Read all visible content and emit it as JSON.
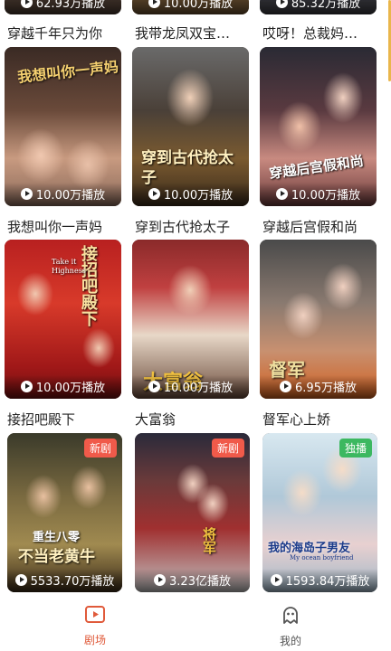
{
  "top_row": {
    "counts": [
      "62.93万播放",
      "10.00万播放",
      "85.32万播放"
    ],
    "titles": [
      "穿越千年只为你",
      "我带龙凤双宝…",
      "哎呀！总裁妈…"
    ]
  },
  "row1": [
    {
      "count": "10.00万播放",
      "poster_text": "我想叫你一声妈"
    },
    {
      "count": "10.00万播放",
      "poster_text": "穿到古代抢太子"
    },
    {
      "count": "10.00万播放",
      "poster_text": "穿越后宫假和尚"
    }
  ],
  "row1_titles": [
    "我想叫你一声妈",
    "穿到古代抢太子",
    "穿越后宫假和尚"
  ],
  "row2": [
    {
      "count": "10.00万播放",
      "poster_text": "接招吧殿下",
      "poster_sub": "Take it Highness"
    },
    {
      "count": "10.00万播放",
      "poster_text": "大富翁"
    },
    {
      "count": "6.95万播放",
      "poster_text": "督军"
    }
  ],
  "row2_titles": [
    "接招吧殿下",
    "大富翁",
    "督军心上娇"
  ],
  "row3": [
    {
      "count": "5533.70万播放",
      "badge": "新剧",
      "poster_text": "不当老黄牛",
      "poster_sub": "重生八零"
    },
    {
      "count": "3.23亿播放",
      "badge": "新剧",
      "poster_text": "将军"
    },
    {
      "count": "1593.84万播放",
      "badge": "独播",
      "poster_text": "我的海岛子男友",
      "poster_sub": "My ocean boyfriend"
    }
  ],
  "tabbar": {
    "theater_label": "剧场",
    "mine_label": "我的"
  },
  "colors": {
    "accent": "#e05a3a",
    "badge_new": "#f05a4a",
    "badge_exclusive": "#3cb860",
    "tab_inactive": "#555555"
  }
}
